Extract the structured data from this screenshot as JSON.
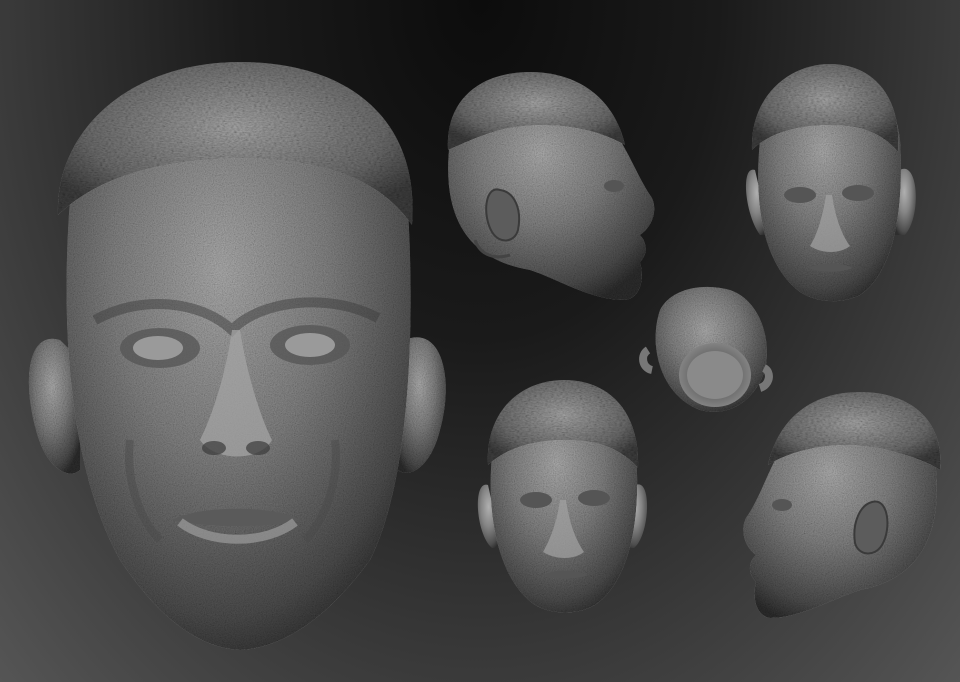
{
  "scene": {
    "description_kind": "3d-sculpt-render",
    "background_top": "#0a0a0a",
    "background_bottom": "#565656",
    "clay_color": "#7c7c7c",
    "views": [
      {
        "name": "front-large"
      },
      {
        "name": "side-right-top"
      },
      {
        "name": "front-small-top"
      },
      {
        "name": "underside"
      },
      {
        "name": "front-small-bottom"
      },
      {
        "name": "side-left-bottom"
      }
    ]
  }
}
